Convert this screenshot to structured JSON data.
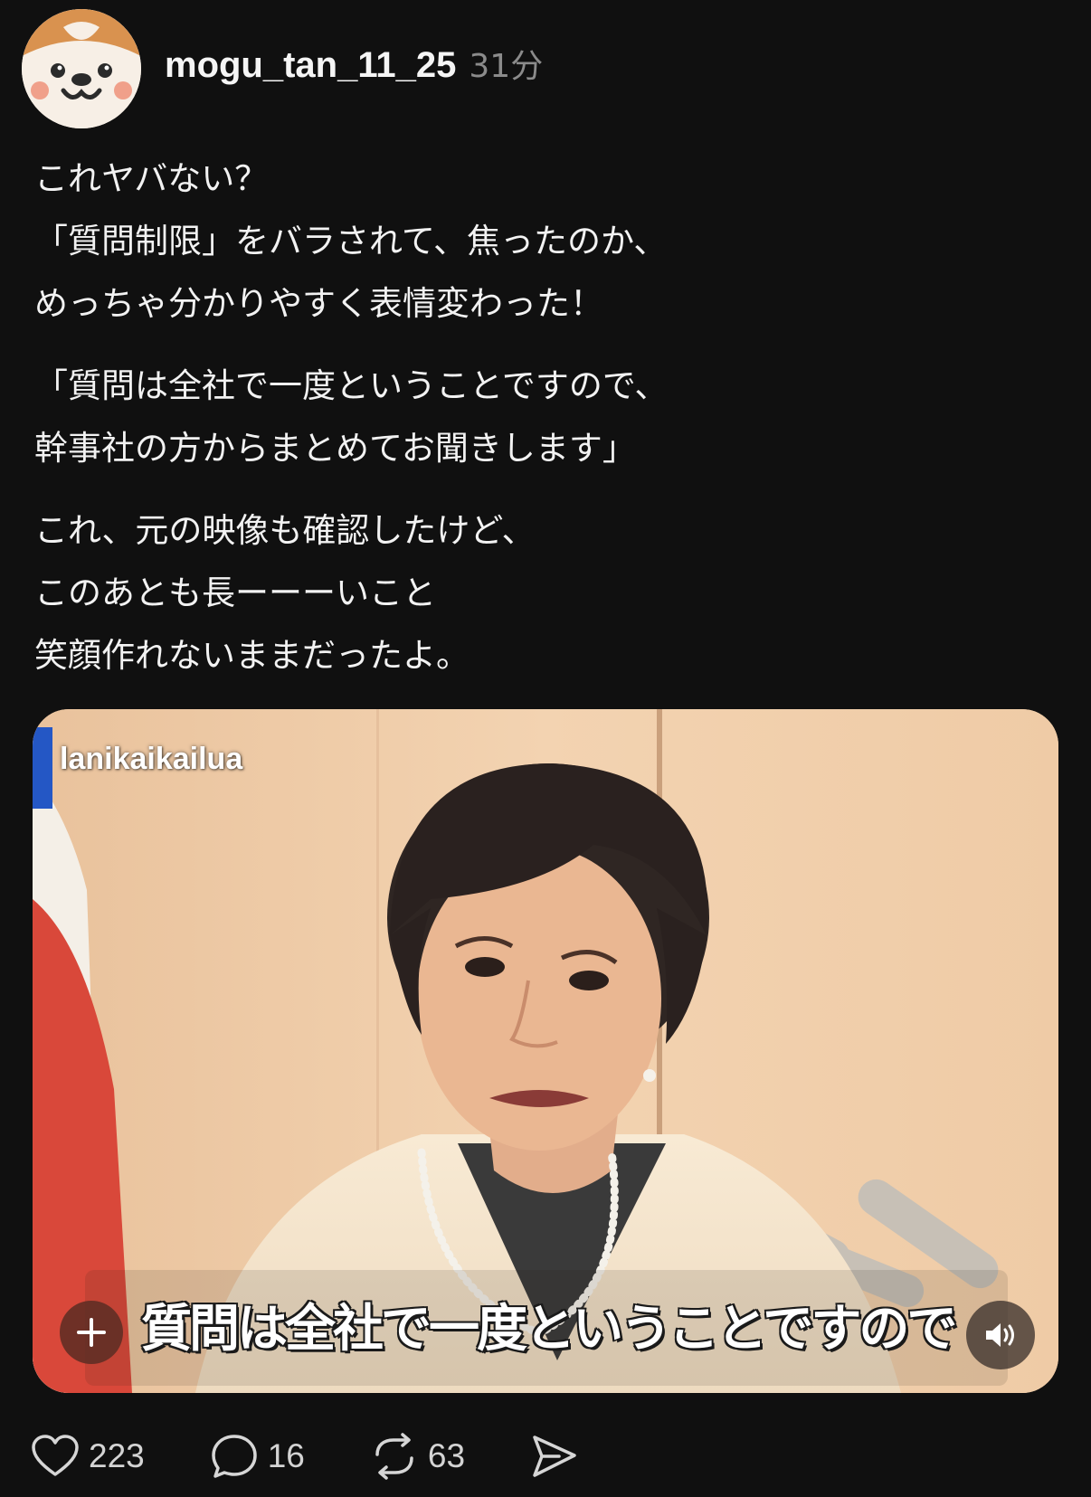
{
  "post": {
    "username": "mogu_tan_11_25",
    "time_ago": "31分",
    "paragraphs": [
      [
        "これヤバない？",
        "「質問制限」をバラされて、焦ったのか、",
        "めっちゃ分かりやすく表情変わった！"
      ],
      [
        "「質問は全社で一度ということですので、",
        "幹事社の方からまとめてお聞きします」"
      ],
      [
        "これ、元の映像も確認したけど、",
        "このあとも長ーーーいこと",
        "笑顔作れないままだったよ。"
      ]
    ]
  },
  "media": {
    "watermark": "lanikaikailua",
    "subtitle": "質問は全社で一度ということですので",
    "plus_icon": "plus-icon",
    "volume_icon": "speaker-icon"
  },
  "actions": {
    "likes": "223",
    "comments": "16",
    "reposts": "63",
    "icons": [
      "heart-icon",
      "comment-icon",
      "repost-icon",
      "share-icon"
    ]
  },
  "colors": {
    "background": "#101010",
    "text": "#f2f2f2",
    "muted": "#8b8b8b"
  }
}
